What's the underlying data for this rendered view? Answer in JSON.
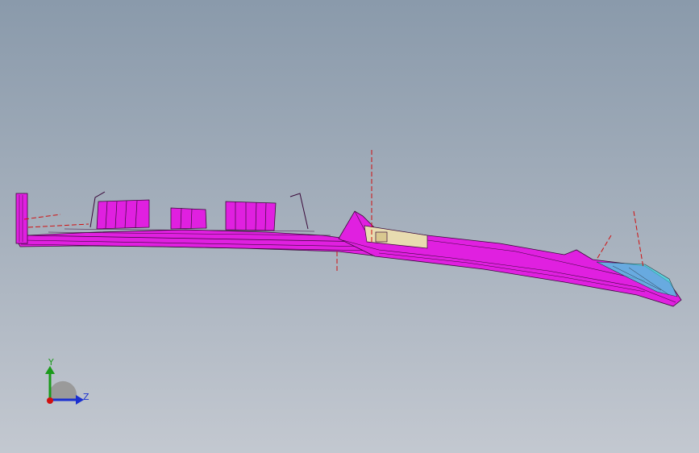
{
  "viewport": {
    "background_top": "#8a9aab",
    "background_bottom": "#c3c8d0"
  },
  "model": {
    "part_color": "#e020e0",
    "edge_color": "#3a0a3a",
    "accent_beige": "#e8dcb0",
    "accent_cyan": "#40d8e0",
    "centerline_color": "#d01010"
  },
  "triad": {
    "y_label": "Y",
    "z_label": "Z",
    "y_color": "#1a9a1a",
    "z_color": "#1a2fd0",
    "origin_color": "#d01010"
  }
}
